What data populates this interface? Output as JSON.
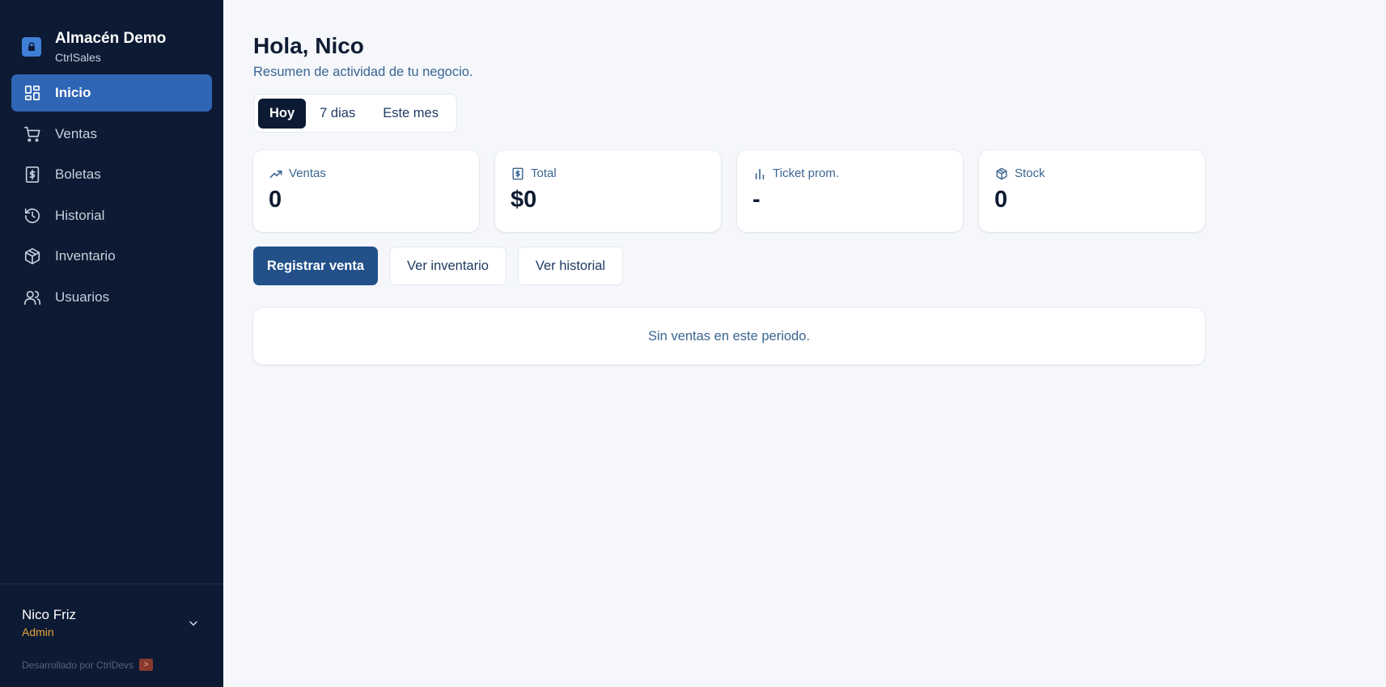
{
  "brand": {
    "title": "Almacén Demo",
    "subtitle": "CtrlSales",
    "icon": "store-lock-icon"
  },
  "nav": {
    "items": [
      {
        "label": "Inicio",
        "icon": "dashboard-grid-icon",
        "active": true
      },
      {
        "label": "Ventas",
        "icon": "cart-icon",
        "active": false
      },
      {
        "label": "Boletas",
        "icon": "receipt-dollar-icon",
        "active": false
      },
      {
        "label": "Historial",
        "icon": "history-icon",
        "active": false
      },
      {
        "label": "Inventario",
        "icon": "box-icon",
        "active": false
      },
      {
        "label": "Usuarios",
        "icon": "users-icon",
        "active": false
      }
    ]
  },
  "user": {
    "name": "Nico Friz",
    "role": "Admin"
  },
  "footer": {
    "credit": "Desarrollado por CtrlDevs",
    "badge": ">"
  },
  "header": {
    "greeting": "Hola, Nico",
    "subtitle": "Resumen de actividad de tu negocio."
  },
  "periods": {
    "items": [
      "Hoy",
      "7 dias",
      "Este mes"
    ],
    "selected": "Hoy"
  },
  "stats": [
    {
      "label": "Ventas",
      "value": "0",
      "icon": "trending-up-icon"
    },
    {
      "label": "Total",
      "value": "$0",
      "icon": "dollar-receipt-icon"
    },
    {
      "label": "Ticket prom.",
      "value": "-",
      "icon": "bar-chart-icon"
    },
    {
      "label": "Stock",
      "value": "0",
      "icon": "box-icon"
    }
  ],
  "actions": {
    "primary": "Registrar venta",
    "inventory": "Ver inventario",
    "history": "Ver historial"
  },
  "empty_state": "Sin ventas en este periodo.",
  "colors": {
    "sidebar_bg": "#0c1a33",
    "accent": "#2f65b5",
    "primary_button": "#235089",
    "role": "#e9a23b"
  }
}
